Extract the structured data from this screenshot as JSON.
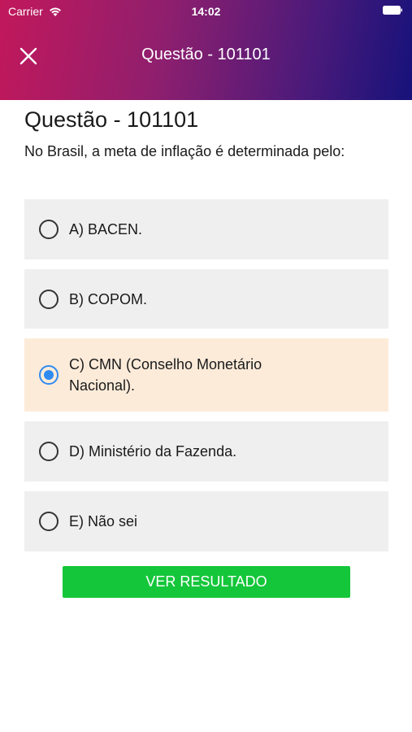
{
  "status_bar": {
    "carrier": "Carrier",
    "time": "14:02"
  },
  "nav": {
    "title": "Questão - 101101",
    "close_icon": "close-icon"
  },
  "question": {
    "title": "Questão - 101101",
    "text": "No Brasil, a meta de inflação é determinada pelo:"
  },
  "options": [
    {
      "label": "A) BACEN.",
      "selected": false
    },
    {
      "label": "B) COPOM.",
      "selected": false
    },
    {
      "label": "C) CMN (Conselho Monetário Nacional).",
      "selected": true
    },
    {
      "label": "D) Ministério da Fazenda.",
      "selected": false
    },
    {
      "label": "E) Não sei",
      "selected": false
    }
  ],
  "result_button": {
    "label": "VER RESULTADO"
  },
  "colors": {
    "header_gradient_start": "#c2185b",
    "header_gradient_end": "#16127a",
    "option_background": "#efefef",
    "selected_option_background": "#fdebd9",
    "radio_selected": "#2f8bf0",
    "result_button": "#14c63a"
  }
}
